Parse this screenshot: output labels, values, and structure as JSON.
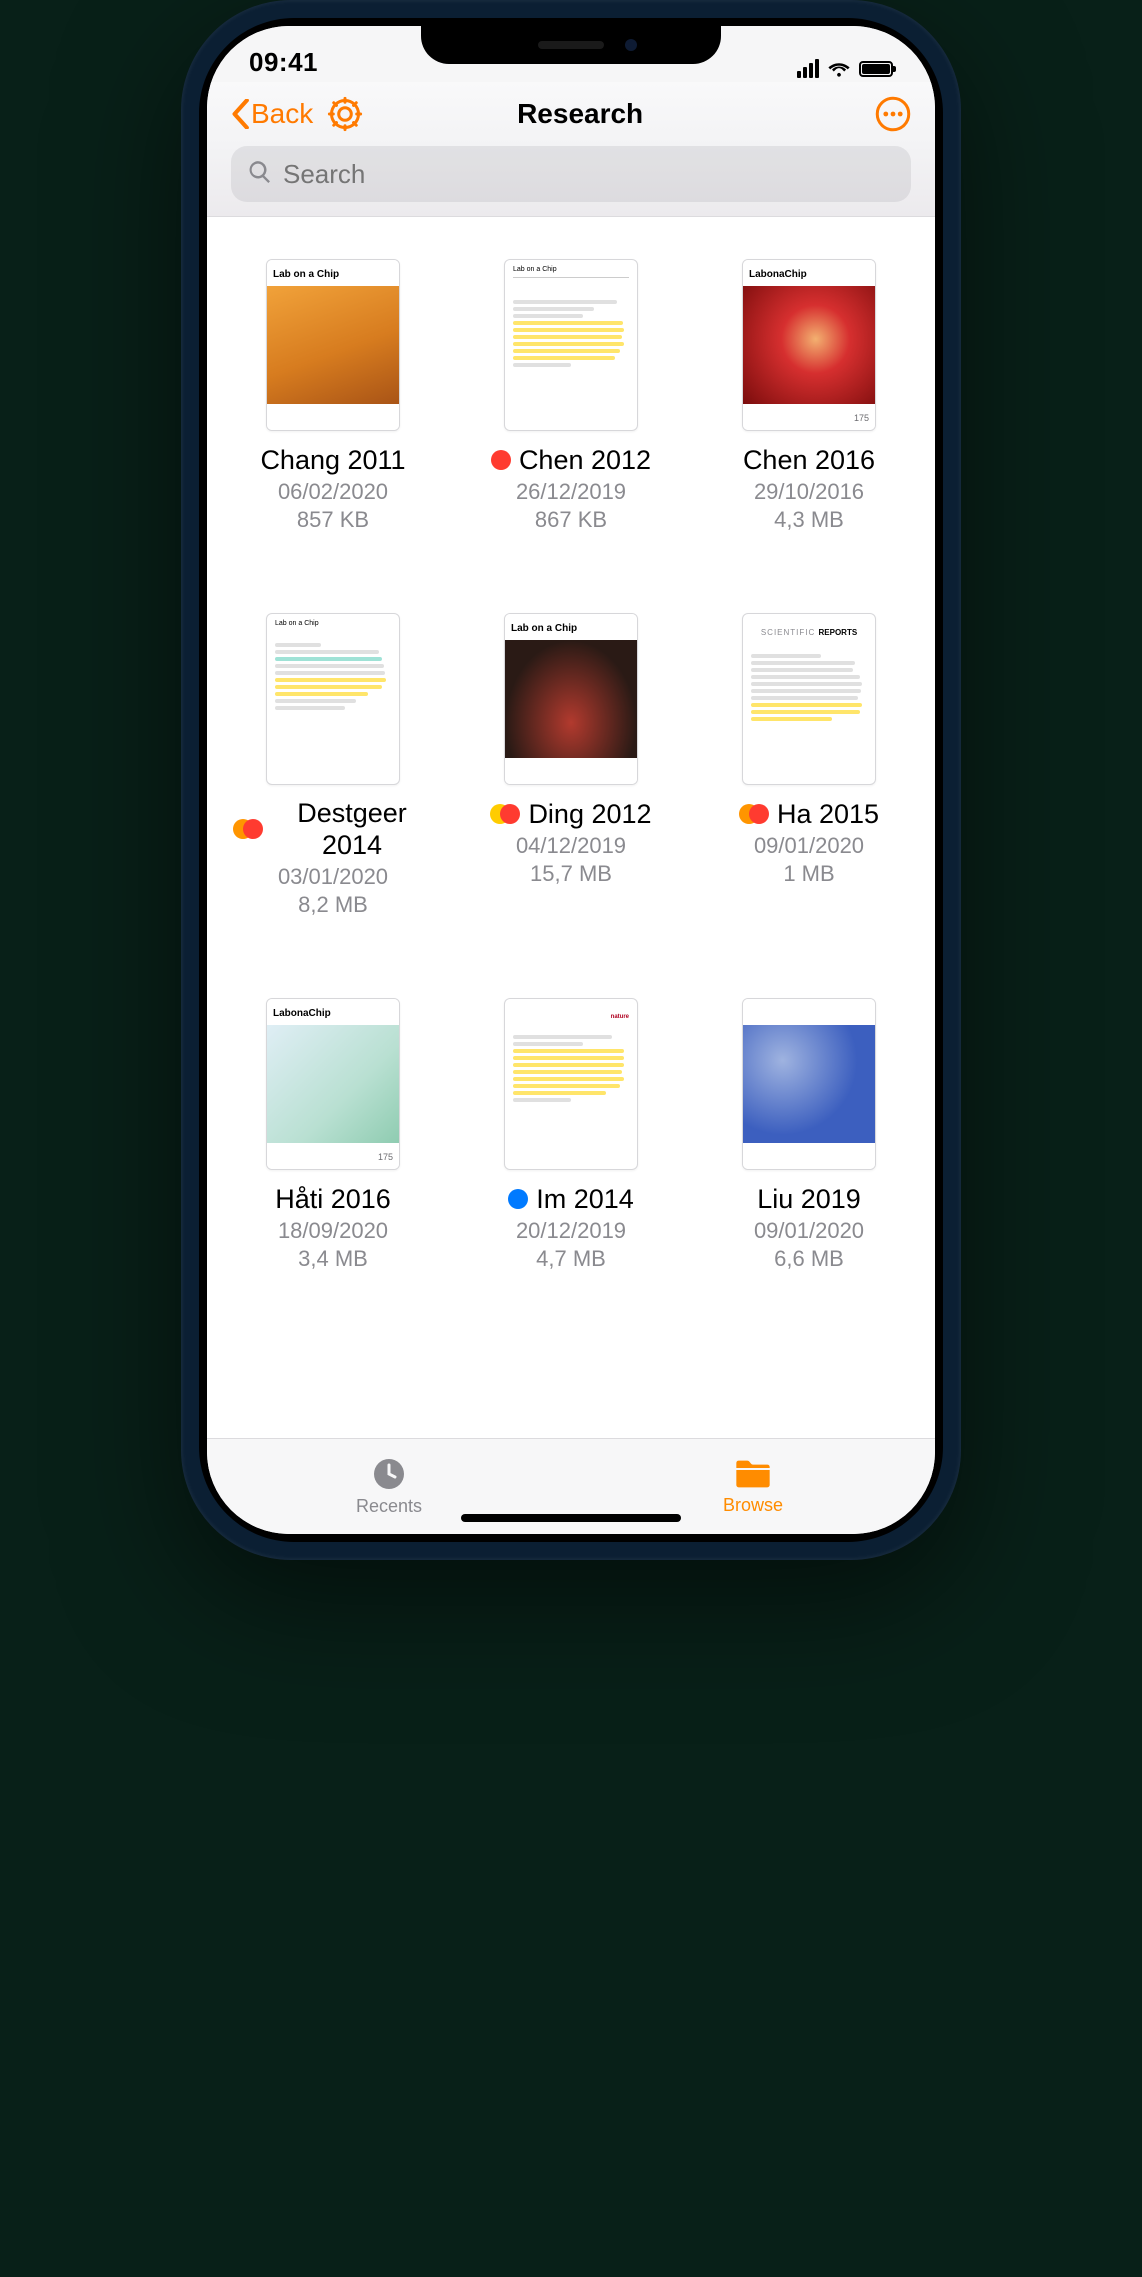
{
  "status": {
    "time": "09:41"
  },
  "nav": {
    "back_label": "Back",
    "title": "Research"
  },
  "search": {
    "placeholder": "Search"
  },
  "tabs": [
    {
      "id": "recents",
      "label": "Recents",
      "active": false
    },
    {
      "id": "browse",
      "label": "Browse",
      "active": true
    }
  ],
  "files": [
    {
      "name": "Chang 2011",
      "date": "06/02/2020",
      "size": "857 KB",
      "tags": [],
      "thumb": "cover-loc-orange"
    },
    {
      "name": "Chen 2012",
      "date": "26/12/2019",
      "size": "867 KB",
      "tags": [
        "#ff3b30"
      ],
      "thumb": "text-highlight"
    },
    {
      "name": "Chen 2016",
      "date": "29/10/2016",
      "size": "4,3 MB",
      "tags": [],
      "thumb": "cover-loc-red"
    },
    {
      "name": "Destgeer 2014",
      "date": "03/01/2020",
      "size": "8,2 MB",
      "tags": [
        "#ff9500",
        "#ff3b30"
      ],
      "thumb": "text-mix"
    },
    {
      "name": "Ding 2012",
      "date": "04/12/2019",
      "size": "15,7 MB",
      "tags": [
        "#ffcc00",
        "#ff3b30"
      ],
      "thumb": "cover-loc-dark"
    },
    {
      "name": "Ha 2015",
      "date": "09/01/2020",
      "size": "1 MB",
      "tags": [
        "#ff9500",
        "#ff3b30"
      ],
      "thumb": "scirep"
    },
    {
      "name": "Håti 2016",
      "date": "18/09/2020",
      "size": "3,4 MB",
      "tags": [],
      "thumb": "cover-loc-green"
    },
    {
      "name": "Im 2014",
      "date": "20/12/2019",
      "size": "4,7 MB",
      "tags": [
        "#007aff"
      ],
      "thumb": "text-yellow"
    },
    {
      "name": "Liu 2019",
      "date": "09/01/2020",
      "size": "6,6 MB",
      "tags": [],
      "thumb": "cover-hex"
    }
  ]
}
